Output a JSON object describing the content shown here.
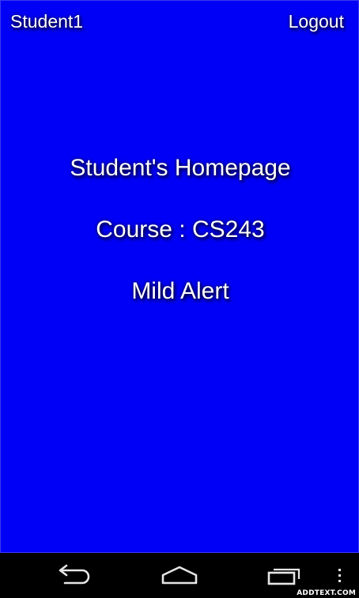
{
  "header": {
    "user_name": "Student1",
    "logout_label": "Logout"
  },
  "main": {
    "title": "Student's Homepage",
    "course_text": "Course : CS243",
    "alert_text": "Mild Alert"
  },
  "nav_bar": {
    "icons": [
      "back-icon",
      "home-icon",
      "recent-apps-icon",
      "overflow-menu-icon"
    ]
  },
  "watermark": "ADDTEXT.COM",
  "colors": {
    "background": "#0000f6",
    "text": "#ffffff",
    "nav_bar": "#000000"
  }
}
